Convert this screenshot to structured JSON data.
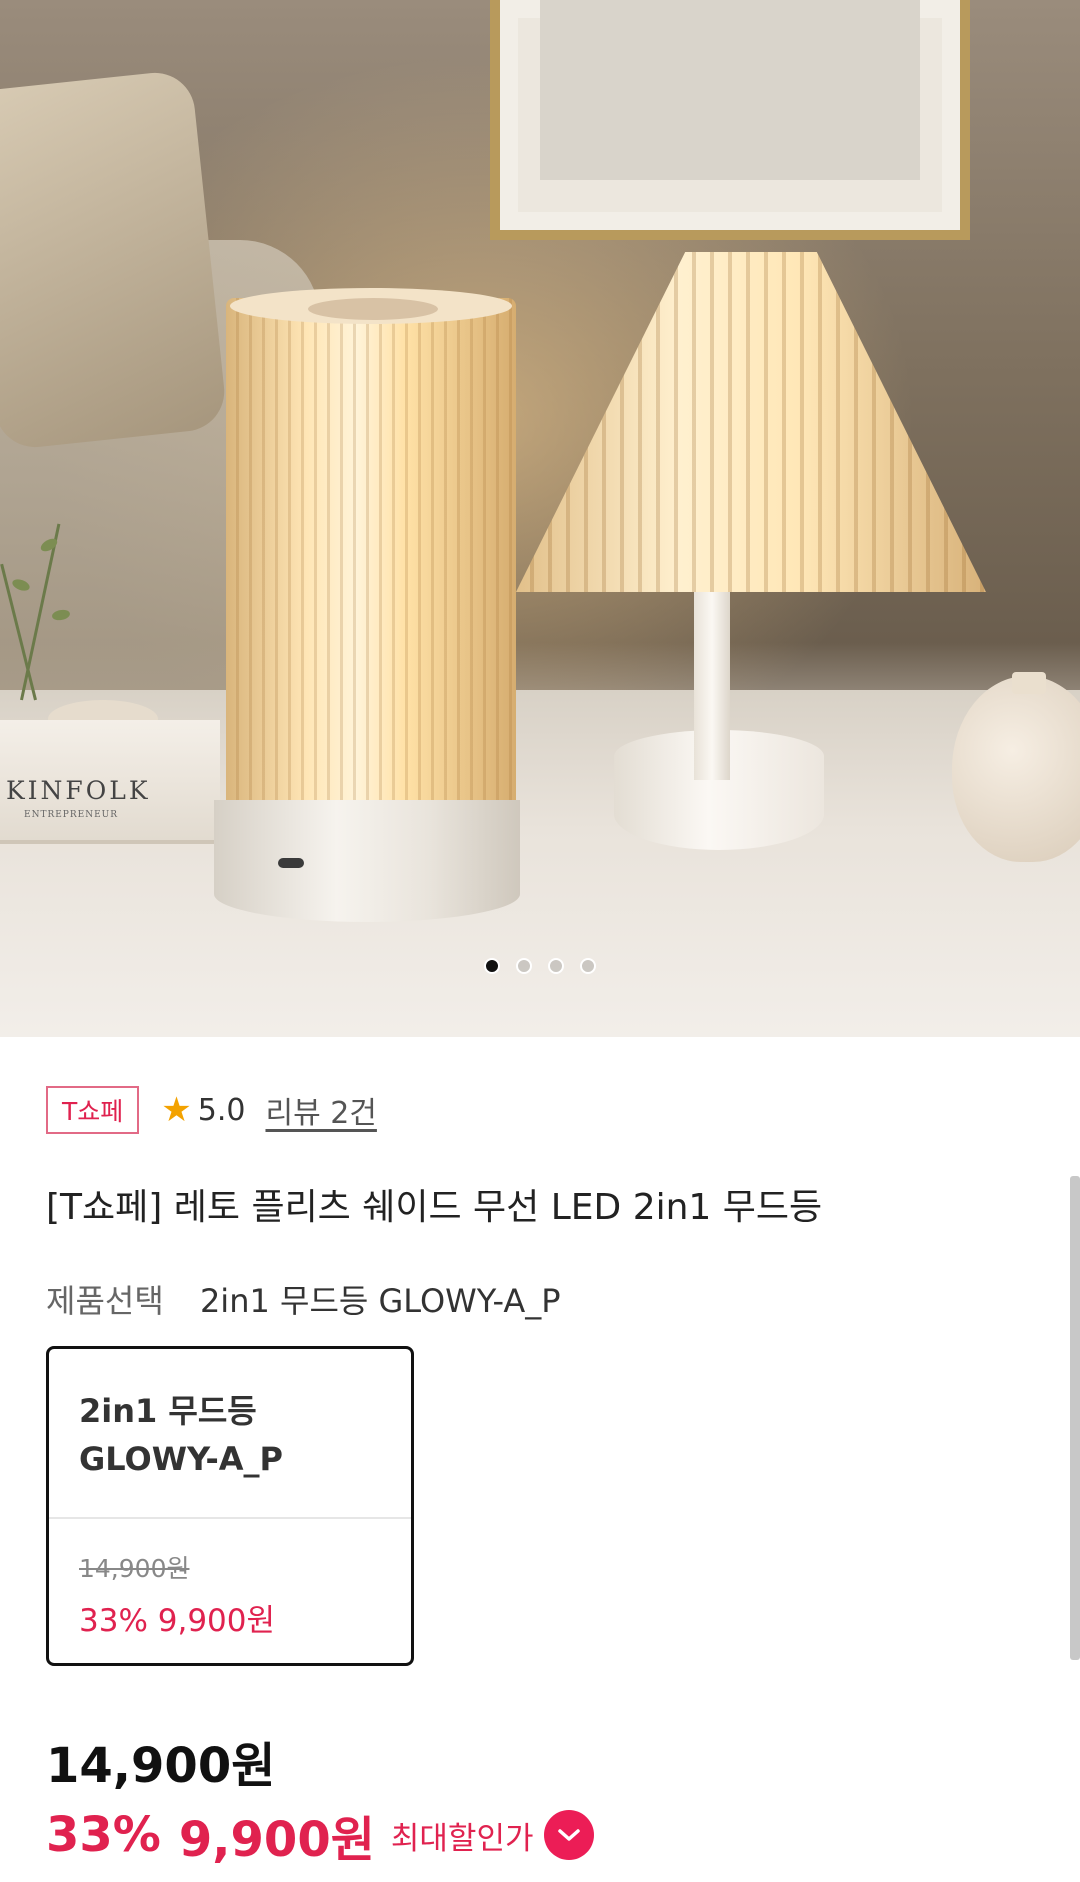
{
  "gallery": {
    "book_title": "KINFOLK",
    "book_subtitle": "ENTREPRENEUR",
    "slide_count": 4,
    "active_slide": 1
  },
  "store": {
    "badge": "T쇼페",
    "rating": "5.0",
    "review_link": "리뷰 2건"
  },
  "product": {
    "title": "[T쇼페] 레토 플리츠 쉐이드 무선 LED 2in1 무드등"
  },
  "option": {
    "label": "제품선택",
    "selected_value": "2in1 무드등 GLOWY-A_P",
    "card": {
      "name": "2in1 무드등 GLOWY-A_P",
      "original_price": "14,900원",
      "sale_price": "33% 9,900원"
    }
  },
  "price": {
    "original": "14,900원",
    "discount_pct": "33%",
    "sale": "9,900원",
    "max_discount_label": "최대할인가"
  },
  "colors": {
    "accent": "#e0224f",
    "badge_border": "#e26a86",
    "star": "#f3a200",
    "chevron_bg": "#ec1d56"
  },
  "icons": {
    "rating": "star-icon",
    "expand": "chevron-down-icon"
  }
}
